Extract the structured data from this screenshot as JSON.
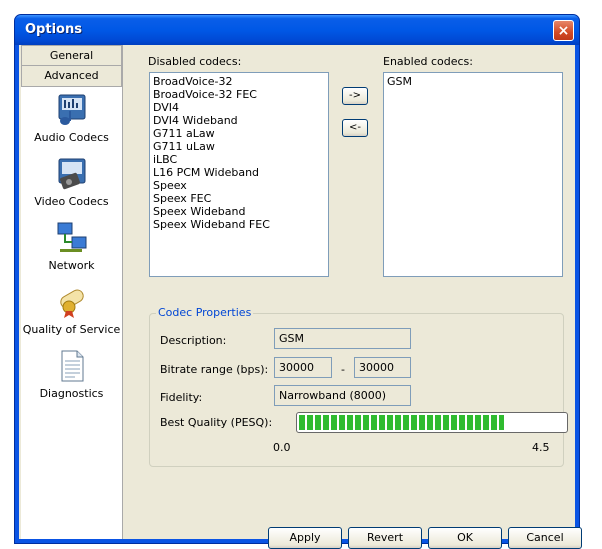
{
  "window": {
    "title": "Options",
    "close_glyph": "×"
  },
  "sidebar": {
    "tabs": [
      "General",
      "Advanced"
    ],
    "items": [
      {
        "label": "Audio Codecs",
        "icon": "audio-codecs-icon"
      },
      {
        "label": "Video Codecs",
        "icon": "video-codecs-icon"
      },
      {
        "label": "Network",
        "icon": "network-icon"
      },
      {
        "label": "Quality of Service",
        "icon": "quality-of-service-icon"
      },
      {
        "label": "Diagnostics",
        "icon": "diagnostics-icon"
      }
    ]
  },
  "codecs": {
    "disabled_label": "Disabled codecs:",
    "enabled_label": "Enabled codecs:",
    "disabled": [
      "BroadVoice-32",
      "BroadVoice-32 FEC",
      "DVI4",
      "DVI4 Wideband",
      "G711 aLaw",
      "G711 uLaw",
      "iLBC",
      "L16 PCM Wideband",
      "Speex",
      "Speex FEC",
      "Speex Wideband",
      "Speex Wideband FEC"
    ],
    "enabled": [
      "GSM"
    ],
    "move_right": "->",
    "move_left": "<-"
  },
  "properties": {
    "group_title": "Codec Properties",
    "description_label": "Description:",
    "description_value": "GSM",
    "bitrate_label": "Bitrate range (bps):",
    "bitrate_min": "30000",
    "bitrate_sep": "-",
    "bitrate_max": "30000",
    "fidelity_label": "Fidelity:",
    "fidelity_value": "Narrowband (8000)",
    "quality_label": "Best Quality (PESQ):",
    "quality_min": "0.0",
    "quality_max": "4.5",
    "quality_fraction": 0.77
  },
  "buttons": {
    "apply": "Apply",
    "revert": "Revert",
    "ok": "OK",
    "cancel": "Cancel"
  },
  "colors": {
    "accent": "#0046d5",
    "progress": "#2fbb2f",
    "title_bar": "#0058e6"
  }
}
